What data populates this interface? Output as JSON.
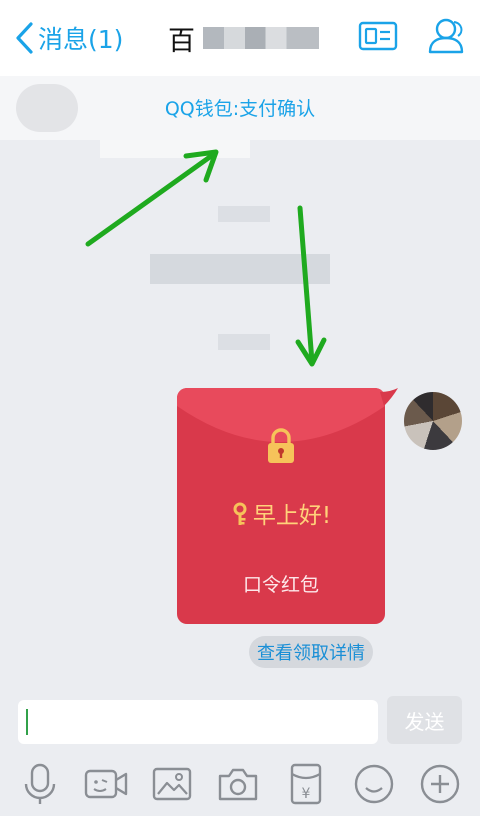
{
  "header": {
    "back_label": "消息(1)",
    "title": "百"
  },
  "notice": {
    "text": "QQ钱包:支付确认"
  },
  "red_packet": {
    "greeting": "早上好!",
    "type_label": "口令红包",
    "details_link": "查看领取详情"
  },
  "input": {
    "value": "",
    "send_label": "发送"
  },
  "toolbar": {
    "items": [
      "microphone-icon",
      "video-call-icon",
      "image-icon",
      "camera-icon",
      "red-packet-icon",
      "emoji-icon",
      "plus-icon"
    ]
  },
  "colors": {
    "accent": "#1aa3e8",
    "packet_red": "#d9394b",
    "packet_gold": "#ffd27a",
    "arrow_green": "#1faa1f"
  }
}
